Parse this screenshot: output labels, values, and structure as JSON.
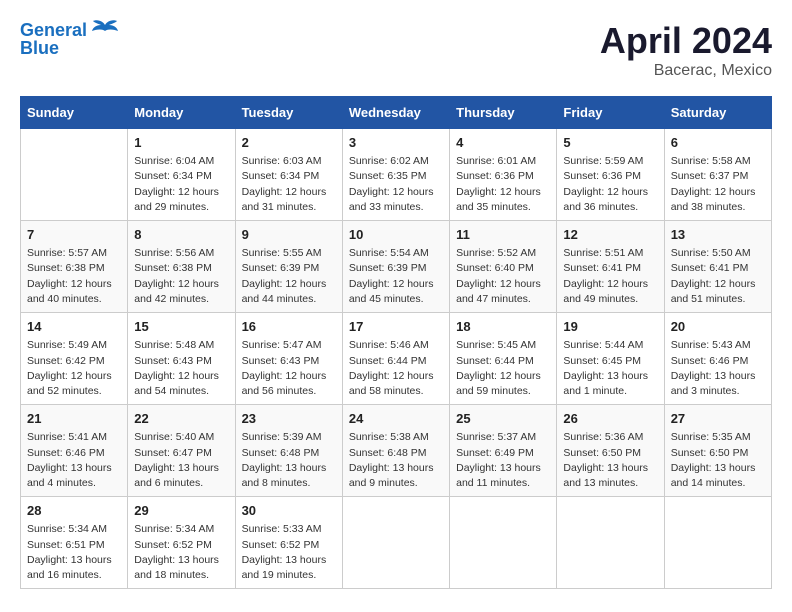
{
  "header": {
    "logo_line1": "General",
    "logo_line2": "Blue",
    "month_title": "April 2024",
    "location": "Bacerac, Mexico"
  },
  "weekdays": [
    "Sunday",
    "Monday",
    "Tuesday",
    "Wednesday",
    "Thursday",
    "Friday",
    "Saturday"
  ],
  "weeks": [
    [
      {
        "day": "",
        "info": ""
      },
      {
        "day": "1",
        "info": "Sunrise: 6:04 AM\nSunset: 6:34 PM\nDaylight: 12 hours\nand 29 minutes."
      },
      {
        "day": "2",
        "info": "Sunrise: 6:03 AM\nSunset: 6:34 PM\nDaylight: 12 hours\nand 31 minutes."
      },
      {
        "day": "3",
        "info": "Sunrise: 6:02 AM\nSunset: 6:35 PM\nDaylight: 12 hours\nand 33 minutes."
      },
      {
        "day": "4",
        "info": "Sunrise: 6:01 AM\nSunset: 6:36 PM\nDaylight: 12 hours\nand 35 minutes."
      },
      {
        "day": "5",
        "info": "Sunrise: 5:59 AM\nSunset: 6:36 PM\nDaylight: 12 hours\nand 36 minutes."
      },
      {
        "day": "6",
        "info": "Sunrise: 5:58 AM\nSunset: 6:37 PM\nDaylight: 12 hours\nand 38 minutes."
      }
    ],
    [
      {
        "day": "7",
        "info": "Sunrise: 5:57 AM\nSunset: 6:38 PM\nDaylight: 12 hours\nand 40 minutes."
      },
      {
        "day": "8",
        "info": "Sunrise: 5:56 AM\nSunset: 6:38 PM\nDaylight: 12 hours\nand 42 minutes."
      },
      {
        "day": "9",
        "info": "Sunrise: 5:55 AM\nSunset: 6:39 PM\nDaylight: 12 hours\nand 44 minutes."
      },
      {
        "day": "10",
        "info": "Sunrise: 5:54 AM\nSunset: 6:39 PM\nDaylight: 12 hours\nand 45 minutes."
      },
      {
        "day": "11",
        "info": "Sunrise: 5:52 AM\nSunset: 6:40 PM\nDaylight: 12 hours\nand 47 minutes."
      },
      {
        "day": "12",
        "info": "Sunrise: 5:51 AM\nSunset: 6:41 PM\nDaylight: 12 hours\nand 49 minutes."
      },
      {
        "day": "13",
        "info": "Sunrise: 5:50 AM\nSunset: 6:41 PM\nDaylight: 12 hours\nand 51 minutes."
      }
    ],
    [
      {
        "day": "14",
        "info": "Sunrise: 5:49 AM\nSunset: 6:42 PM\nDaylight: 12 hours\nand 52 minutes."
      },
      {
        "day": "15",
        "info": "Sunrise: 5:48 AM\nSunset: 6:43 PM\nDaylight: 12 hours\nand 54 minutes."
      },
      {
        "day": "16",
        "info": "Sunrise: 5:47 AM\nSunset: 6:43 PM\nDaylight: 12 hours\nand 56 minutes."
      },
      {
        "day": "17",
        "info": "Sunrise: 5:46 AM\nSunset: 6:44 PM\nDaylight: 12 hours\nand 58 minutes."
      },
      {
        "day": "18",
        "info": "Sunrise: 5:45 AM\nSunset: 6:44 PM\nDaylight: 12 hours\nand 59 minutes."
      },
      {
        "day": "19",
        "info": "Sunrise: 5:44 AM\nSunset: 6:45 PM\nDaylight: 13 hours\nand 1 minute."
      },
      {
        "day": "20",
        "info": "Sunrise: 5:43 AM\nSunset: 6:46 PM\nDaylight: 13 hours\nand 3 minutes."
      }
    ],
    [
      {
        "day": "21",
        "info": "Sunrise: 5:41 AM\nSunset: 6:46 PM\nDaylight: 13 hours\nand 4 minutes."
      },
      {
        "day": "22",
        "info": "Sunrise: 5:40 AM\nSunset: 6:47 PM\nDaylight: 13 hours\nand 6 minutes."
      },
      {
        "day": "23",
        "info": "Sunrise: 5:39 AM\nSunset: 6:48 PM\nDaylight: 13 hours\nand 8 minutes."
      },
      {
        "day": "24",
        "info": "Sunrise: 5:38 AM\nSunset: 6:48 PM\nDaylight: 13 hours\nand 9 minutes."
      },
      {
        "day": "25",
        "info": "Sunrise: 5:37 AM\nSunset: 6:49 PM\nDaylight: 13 hours\nand 11 minutes."
      },
      {
        "day": "26",
        "info": "Sunrise: 5:36 AM\nSunset: 6:50 PM\nDaylight: 13 hours\nand 13 minutes."
      },
      {
        "day": "27",
        "info": "Sunrise: 5:35 AM\nSunset: 6:50 PM\nDaylight: 13 hours\nand 14 minutes."
      }
    ],
    [
      {
        "day": "28",
        "info": "Sunrise: 5:34 AM\nSunset: 6:51 PM\nDaylight: 13 hours\nand 16 minutes."
      },
      {
        "day": "29",
        "info": "Sunrise: 5:34 AM\nSunset: 6:52 PM\nDaylight: 13 hours\nand 18 minutes."
      },
      {
        "day": "30",
        "info": "Sunrise: 5:33 AM\nSunset: 6:52 PM\nDaylight: 13 hours\nand 19 minutes."
      },
      {
        "day": "",
        "info": ""
      },
      {
        "day": "",
        "info": ""
      },
      {
        "day": "",
        "info": ""
      },
      {
        "day": "",
        "info": ""
      }
    ]
  ]
}
